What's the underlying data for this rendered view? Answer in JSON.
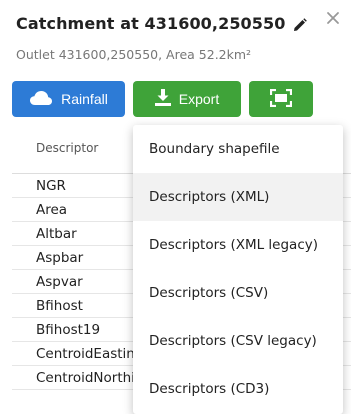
{
  "header": {
    "title": "Catchment at 431600,250550",
    "subtitle": "Outlet 431600,250550, Area 52.2km²"
  },
  "toolbar": {
    "rainfall_label": "Rainfall",
    "export_label": "Export"
  },
  "table": {
    "column_header": "Descriptor",
    "rows": [
      "NGR",
      "Area",
      "Altbar",
      "Aspbar",
      "Aspvar",
      "Bfihost",
      "Bfihost19",
      "CentroidEasting",
      "CentroidNorthing"
    ]
  },
  "export_menu": {
    "items": [
      "Boundary shapefile",
      "Descriptors (XML)",
      "Descriptors (XML legacy)",
      "Descriptors (CSV)",
      "Descriptors (CSV legacy)",
      "Descriptors (CD3)"
    ],
    "hovered_index": 1
  },
  "colors": {
    "primary": "#2d7bd6",
    "success": "#3fa339"
  },
  "icons": {
    "edit": "pencil-icon",
    "close": "close-icon",
    "rainfall": "cloud-icon",
    "export": "download-icon",
    "fit": "fullscreen-icon"
  }
}
